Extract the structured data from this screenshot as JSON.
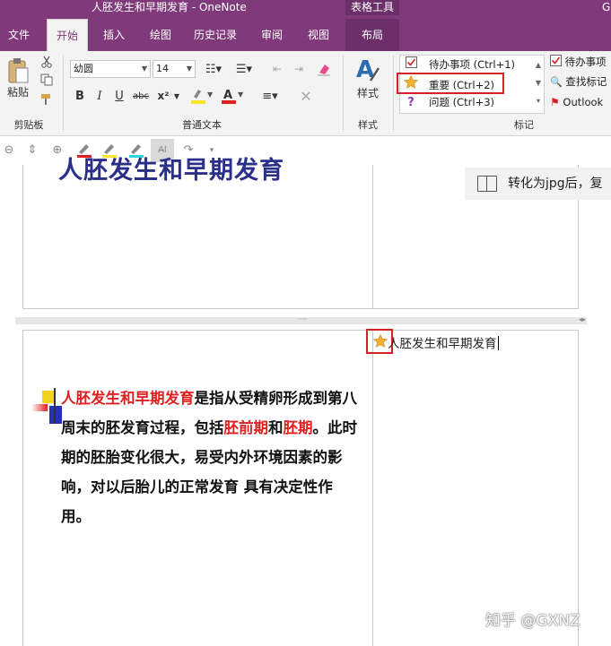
{
  "titlebar": {
    "title": "人胚发生和早期发育 - OneNote",
    "context_tab": "表格工具",
    "corner": "G"
  },
  "tabs": [
    "文件",
    "开始",
    "插入",
    "绘图",
    "历史记录",
    "审阅",
    "视图",
    "布局"
  ],
  "active_tab": "开始",
  "ribbon": {
    "clipboard": {
      "paste_label": "粘贴",
      "group_label": "剪贴板"
    },
    "basic_text": {
      "font_name": "幼圆",
      "font_size": "14",
      "group_label": "普通文本",
      "bold": "B",
      "italic": "I",
      "underline": "U",
      "strike": "abc",
      "superscript": "x²"
    },
    "styles": {
      "label": "样式",
      "group_label": "样式"
    },
    "tags": {
      "items": [
        {
          "icon": "checkbox-icon",
          "label": "待办事项 (Ctrl+1)"
        },
        {
          "icon": "star-icon",
          "label": "重要 (Ctrl+2)"
        },
        {
          "icon": "question-icon",
          "label": "问题 (Ctrl+3)"
        }
      ],
      "group_label": "标记",
      "side": [
        "待办事项",
        "查找标记",
        "Outlook"
      ]
    }
  },
  "page": {
    "top_title": "人胚发生和早期发育",
    "callout_text": "转化为jpg后，复",
    "note_title": "人胚发生和早期发育",
    "paragraph": [
      {
        "text": "人胚发生和早期发育",
        "red": true
      },
      {
        "text": "是指从受精卵形成到第八周末的胚发育过程，包括",
        "red": false
      },
      {
        "text": "胚前期",
        "red": true
      },
      {
        "text": "和",
        "red": false
      },
      {
        "text": "胚期",
        "red": true
      },
      {
        "text": "。此时期的胚胎变化很大，易受内外环境因素的影响，对以后胎儿的正常发育 具有决定性作用。",
        "red": false
      }
    ],
    "watermark": "知乎 @GXNZ"
  },
  "colors": {
    "title_bar": "#80397b",
    "context_tab": "#6d2f69",
    "ribbon_bg": "#f3f3f3",
    "highlight_red": "#d61f26",
    "heading_blue": "#2a2f8a",
    "star": "#f2b233"
  }
}
